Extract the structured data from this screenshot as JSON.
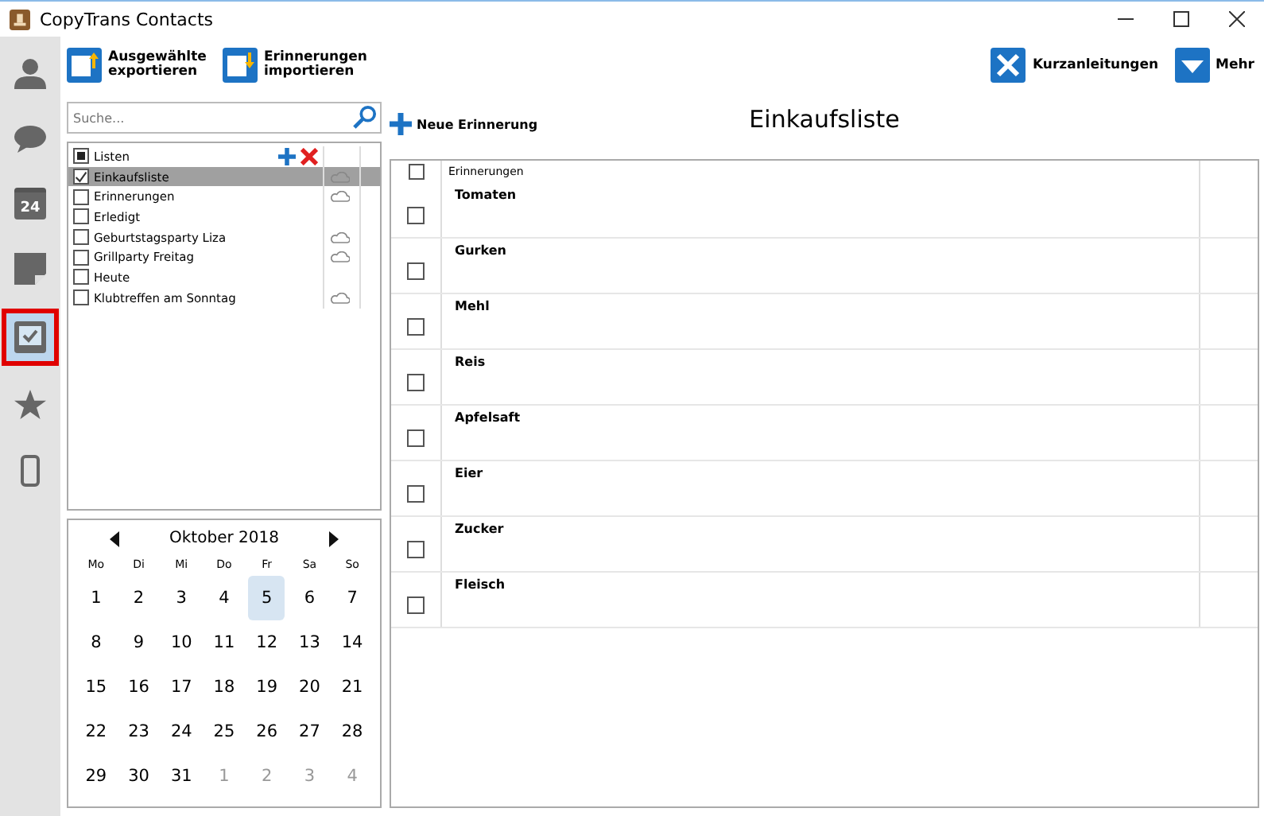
{
  "window": {
    "title": "CopyTrans Contacts"
  },
  "sidebar": {
    "items": [
      {
        "kind": "person",
        "selected": false
      },
      {
        "kind": "chat",
        "selected": false
      },
      {
        "kind": "calendar",
        "badge": "24",
        "selected": false
      },
      {
        "kind": "note",
        "selected": false
      },
      {
        "kind": "tasks",
        "selected": true
      },
      {
        "kind": "star",
        "selected": false
      },
      {
        "kind": "phone",
        "selected": false
      }
    ]
  },
  "toolbar": {
    "left": [
      {
        "kind": "export",
        "label": "Ausgewählte exportieren"
      },
      {
        "kind": "import",
        "label": "Erinnerungen importieren"
      }
    ],
    "right": [
      {
        "kind": "tools",
        "label": "Kurzanleitungen"
      },
      {
        "kind": "more",
        "label": "Mehr"
      }
    ]
  },
  "search": {
    "placeholder": "Suche..."
  },
  "lists": {
    "header": {
      "label": "Listen",
      "partial": true
    },
    "items": [
      {
        "name": "Einkaufsliste",
        "checked": true,
        "selected": true,
        "cloud": true
      },
      {
        "name": "Erinnerungen",
        "checked": false,
        "selected": false,
        "cloud": true
      },
      {
        "name": "Erledigt",
        "checked": false,
        "selected": false,
        "cloud": false
      },
      {
        "name": "Geburtstagsparty Liza",
        "checked": false,
        "selected": false,
        "cloud": true
      },
      {
        "name": "Grillparty Freitag",
        "checked": false,
        "selected": false,
        "cloud": true
      },
      {
        "name": "Heute",
        "checked": false,
        "selected": false,
        "cloud": false
      },
      {
        "name": "Klubtreffen am Sonntag",
        "checked": false,
        "selected": false,
        "cloud": true
      }
    ]
  },
  "calendar": {
    "month": "Oktober 2018",
    "weekdays": [
      "Mo",
      "Di",
      "Mi",
      "Do",
      "Fr",
      "Sa",
      "So"
    ],
    "days": [
      {
        "label": "1",
        "other_month": false,
        "selected": false
      },
      {
        "label": "2",
        "other_month": false,
        "selected": false
      },
      {
        "label": "3",
        "other_month": false,
        "selected": false
      },
      {
        "label": "4",
        "other_month": false,
        "selected": false
      },
      {
        "label": "5",
        "other_month": false,
        "selected": true
      },
      {
        "label": "6",
        "other_month": false,
        "selected": false
      },
      {
        "label": "7",
        "other_month": false,
        "selected": false
      },
      {
        "label": "8",
        "other_month": false,
        "selected": false
      },
      {
        "label": "9",
        "other_month": false,
        "selected": false
      },
      {
        "label": "10",
        "other_month": false,
        "selected": false
      },
      {
        "label": "11",
        "other_month": false,
        "selected": false
      },
      {
        "label": "12",
        "other_month": false,
        "selected": false
      },
      {
        "label": "13",
        "other_month": false,
        "selected": false
      },
      {
        "label": "14",
        "other_month": false,
        "selected": false
      },
      {
        "label": "15",
        "other_month": false,
        "selected": false
      },
      {
        "label": "16",
        "other_month": false,
        "selected": false
      },
      {
        "label": "17",
        "other_month": false,
        "selected": false
      },
      {
        "label": "18",
        "other_month": false,
        "selected": false
      },
      {
        "label": "19",
        "other_month": false,
        "selected": false
      },
      {
        "label": "20",
        "other_month": false,
        "selected": false
      },
      {
        "label": "21",
        "other_month": false,
        "selected": false
      },
      {
        "label": "22",
        "other_month": false,
        "selected": false
      },
      {
        "label": "23",
        "other_month": false,
        "selected": false
      },
      {
        "label": "24",
        "other_month": false,
        "selected": false
      },
      {
        "label": "25",
        "other_month": false,
        "selected": false
      },
      {
        "label": "26",
        "other_month": false,
        "selected": false
      },
      {
        "label": "27",
        "other_month": false,
        "selected": false
      },
      {
        "label": "28",
        "other_month": false,
        "selected": false
      },
      {
        "label": "29",
        "other_month": false,
        "selected": false
      },
      {
        "label": "30",
        "other_month": false,
        "selected": false
      },
      {
        "label": "31",
        "other_month": false,
        "selected": false
      },
      {
        "label": "1",
        "other_month": true,
        "selected": false
      },
      {
        "label": "2",
        "other_month": true,
        "selected": false
      },
      {
        "label": "3",
        "other_month": true,
        "selected": false
      },
      {
        "label": "4",
        "other_month": true,
        "selected": false
      }
    ]
  },
  "main": {
    "new_button": "Neue Erinnerung",
    "title": "Einkaufsliste",
    "column": "Erinnerungen",
    "header_checked": false,
    "rows": [
      {
        "title": "Tomaten",
        "checked": false
      },
      {
        "title": "Gurken",
        "checked": false
      },
      {
        "title": "Mehl",
        "checked": false
      },
      {
        "title": "Reis",
        "checked": false
      },
      {
        "title": "Apfelsaft",
        "checked": false
      },
      {
        "title": "Eier",
        "checked": false
      },
      {
        "title": "Zucker",
        "checked": false
      },
      {
        "title": "Fleisch",
        "checked": false
      }
    ]
  }
}
